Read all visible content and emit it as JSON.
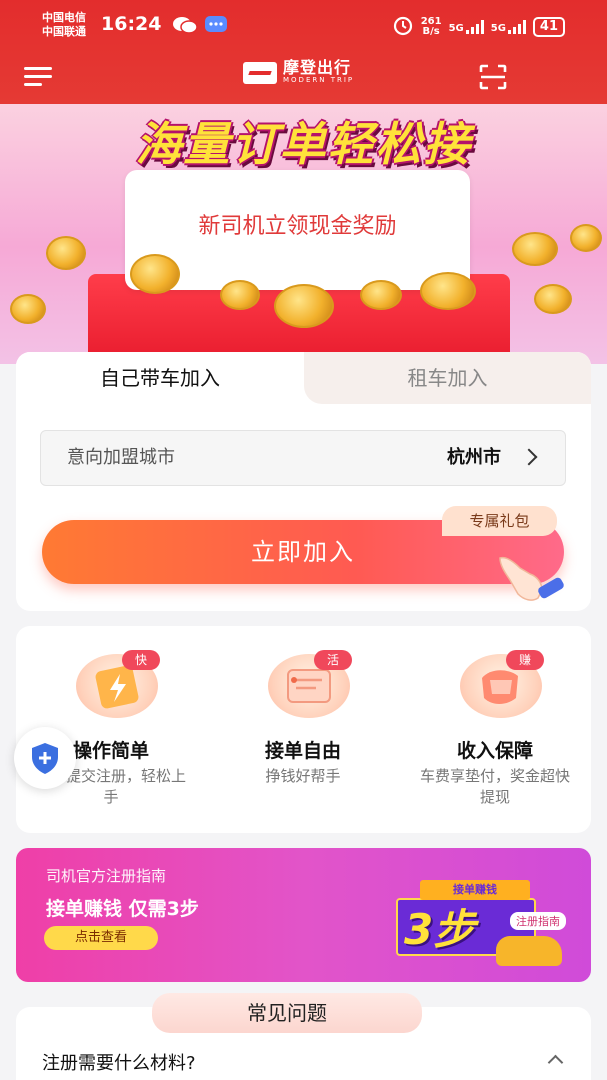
{
  "status_bar": {
    "carrier_1": "中国电信",
    "carrier_2": "中国联通",
    "time": "16:24",
    "net_speed_value": "261",
    "net_speed_unit": "B/s",
    "net_1": "5G",
    "net_2": "5G",
    "battery": "41"
  },
  "app_bar": {
    "brand_name": "摩登出行",
    "brand_sub": "MODERN TRIP"
  },
  "banner": {
    "title": "海量订单轻松接",
    "slip_text": "新司机立领现金奖励"
  },
  "join": {
    "tabs": [
      {
        "label": "自己带车加入",
        "active": true
      },
      {
        "label": "租车加入",
        "active": false
      }
    ],
    "city_label": "意向加盟城市",
    "city_value": "杭州市",
    "gift_tag": "专属礼包",
    "button_label": "立即加入"
  },
  "features": [
    {
      "badge": "快",
      "title": "操作简单",
      "desc": "分钟提交注册，轻松上手"
    },
    {
      "badge": "活",
      "title": "接单自由",
      "desc": "挣钱好帮手"
    },
    {
      "badge": "赚",
      "title": "收入保障",
      "desc": "车费享垫付，奖金超快提现"
    }
  ],
  "guide": {
    "subtitle": "司机官方注册指南",
    "title": "接单赚钱 仅需3步",
    "button": "点击查看",
    "art_ribbon": "接单赚钱",
    "art_steps": "3步",
    "art_tag": "注册指南"
  },
  "faq": {
    "header": "常见问题",
    "question": "注册需要什么材料?"
  },
  "colors": {
    "header_red": "#e32d2d",
    "button_orange": "#ff7a33",
    "button_pink": "#ff6a8a",
    "guide_pink": "#ef3fa7",
    "badge_red": "#f0485b"
  }
}
